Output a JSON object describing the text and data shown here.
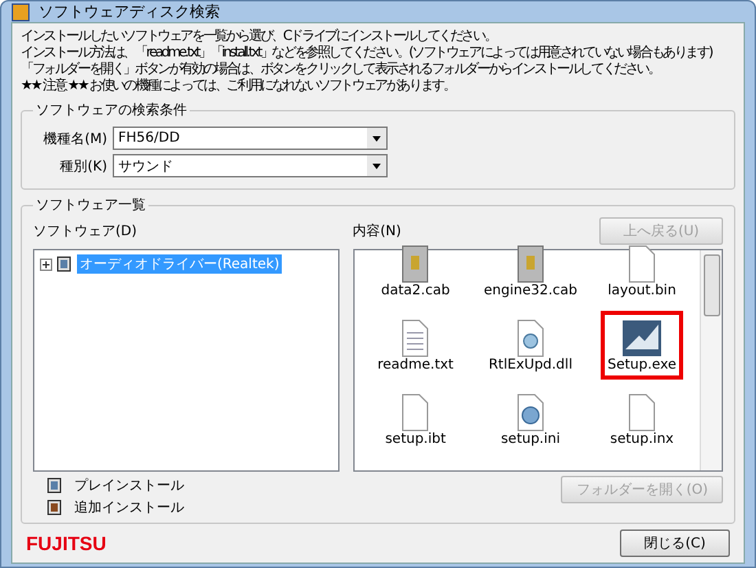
{
  "window": {
    "title": "ソフトウェアディスク検索"
  },
  "instructions": [
    "インストールしたいソフトウェアを一覧から選び、Cドライブにインストールしてください。",
    "インストール方法は、「readme.txt」「install.txt」などを参照してください。(ソフトウェアによっては用意されていない場合もあります)",
    "「フォルダーを開く」ボタンが有効の場合は、ボタンをクリックして表示されるフォルダーからインストールしてください。",
    "★★ 注意 ★★ お使いの機種によっては、ご利用になれないソフトウェアがあります。"
  ],
  "search": {
    "title": "ソフトウェアの検索条件",
    "fields": [
      {
        "label": "機種名(M)",
        "value": "FH56/DD"
      },
      {
        "label": "種別(K)",
        "value": "サウンド"
      }
    ]
  },
  "list": {
    "title": "ソフトウェア一覧",
    "tree_label": "ソフトウェア(D)",
    "tree": [
      {
        "label": "オーディオドライバー(Realtek)",
        "kind": "preinstall",
        "expanded": false,
        "selected": true
      }
    ],
    "content_label": "内容(N)",
    "up_button": {
      "label": "上へ戻る(U)",
      "disabled": true
    },
    "files": [
      {
        "name": "data2.cab",
        "kind": "cab",
        "highlighted": false
      },
      {
        "name": "engine32.cab",
        "kind": "cab",
        "highlighted": false
      },
      {
        "name": "layout.bin",
        "kind": "file",
        "highlighted": false
      },
      {
        "name": "readme.txt",
        "kind": "text",
        "highlighted": false
      },
      {
        "name": "RtlExUpd.dll",
        "kind": "dll",
        "highlighted": false
      },
      {
        "name": "Setup.exe",
        "kind": "exe",
        "highlighted": true
      },
      {
        "name": "setup.ibt",
        "kind": "file",
        "highlighted": false
      },
      {
        "name": "setup.ini",
        "kind": "ini",
        "highlighted": false
      },
      {
        "name": "setup.inx",
        "kind": "file",
        "highlighted": false
      }
    ],
    "legend": [
      {
        "label": "プレインストール",
        "kind": "preinstall"
      },
      {
        "label": "追加インストール",
        "kind": "additional"
      }
    ],
    "open_button": {
      "label": "フォルダーを開く(O)",
      "disabled": true
    }
  },
  "footer": {
    "logo": "FUJITSU",
    "close_button": {
      "label": "閉じる(C)",
      "disabled": false
    }
  }
}
